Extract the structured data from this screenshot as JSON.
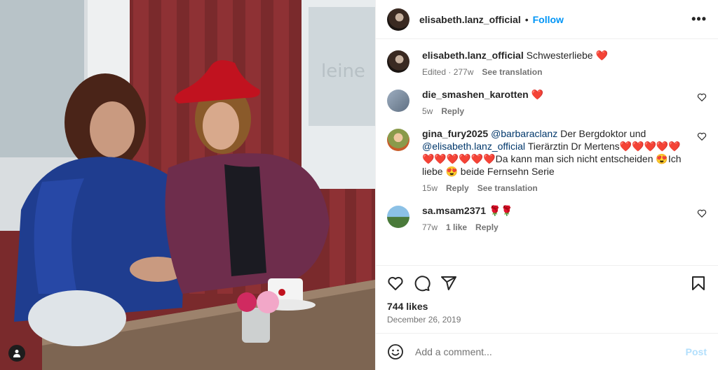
{
  "post": {
    "username": "elisabeth.lanz_official",
    "separator": "•",
    "follow_label": "Follow",
    "more_label": "•••",
    "caption_text": "Schwesterliebe",
    "caption_emoji": "❤️",
    "caption_meta": {
      "edited": "Edited · 277w",
      "translate": "See translation"
    }
  },
  "comments": [
    {
      "user": "die_smashen_karotten",
      "text": "❤️",
      "time": "5w",
      "reply": "Reply"
    },
    {
      "user": "gina_fury2025",
      "mention1": "@barbaraclanz",
      "text1": "Der Bergdoktor und",
      "mention2": "@elisabeth.lanz_official",
      "text2": "Tierärztin Dr Mertens❤️❤️❤️❤️❤️❤️❤️❤️❤️❤️❤️Da kann man sich nicht entscheiden 😍Ich liebe 😍 beide Fernsehn Serie",
      "time": "15w",
      "reply": "Reply",
      "translate": "See translation"
    },
    {
      "user": "sa.msam2371",
      "text": "🌹🌹",
      "time": "77w",
      "likes": "1 like",
      "reply": "Reply"
    }
  ],
  "engagement": {
    "likes": "744 likes",
    "date": "December 26, 2019"
  },
  "composer": {
    "placeholder": "Add a comment...",
    "post_label": "Post"
  },
  "colors": {
    "accent": "#0095f6",
    "heart": "#e0245e",
    "post_disabled": "#b2dffc"
  },
  "icons": [
    "more-icon",
    "heart-icon",
    "comment-icon",
    "share-icon",
    "bookmark-icon",
    "emoji-icon",
    "user-tag-icon"
  ]
}
